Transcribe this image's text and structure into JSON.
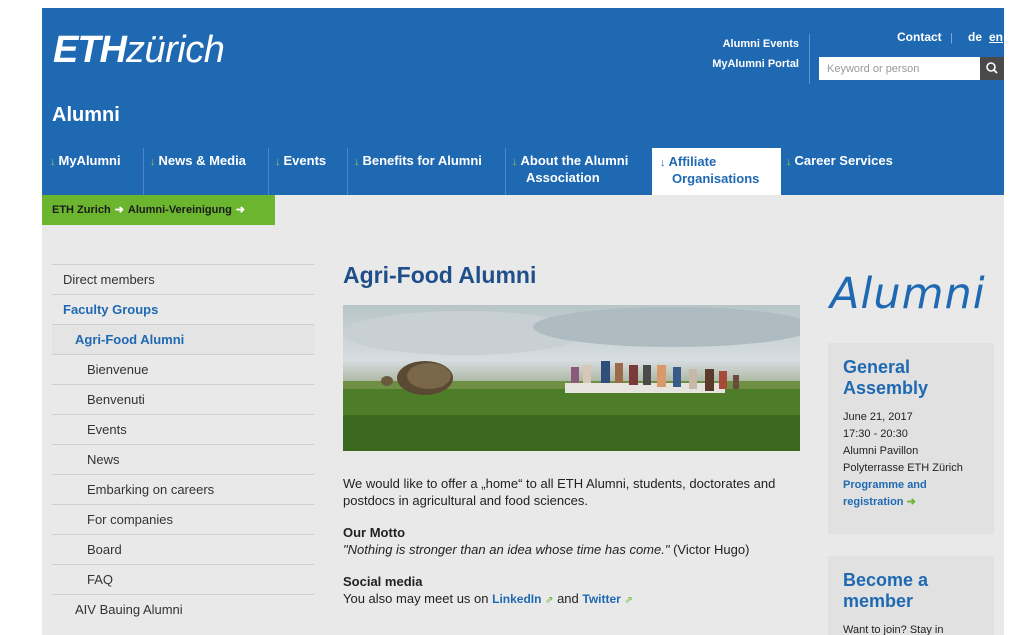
{
  "header": {
    "logo_bold": "ETH",
    "logo_light": "zürich",
    "site_title": "Alumni",
    "toplinks": [
      "Alumni Events",
      "MyAlumni Portal"
    ],
    "contact": "Contact",
    "lang_separator": "|",
    "lang_de": "de",
    "lang_en": "en",
    "search_placeholder": "Keyword or person"
  },
  "nav": {
    "items": [
      {
        "label": "MyAlumni"
      },
      {
        "label": "News & Media"
      },
      {
        "label": "Events"
      },
      {
        "label": "Benefits for Alumni"
      },
      {
        "label1": "About the Alumni",
        "label2": "Association"
      },
      {
        "label1": "Affiliate",
        "label2": "Organisations",
        "active": true
      },
      {
        "label": "Career Services"
      }
    ]
  },
  "breadcrumb": [
    "ETH Zurich",
    "Alumni-Vereinigung"
  ],
  "leftnav": [
    "Direct members",
    "Faculty Groups",
    "Agri-Food Alumni",
    "Bienvenue",
    "Benvenuti",
    "Events",
    "News",
    "Embarking on careers",
    "For companies",
    "Board",
    "FAQ",
    "AIV Bauing Alumni"
  ],
  "main": {
    "title": "Agri-Food Alumni",
    "intro": "We would like to offer a „home“ to all ETH Alumni, students, doctorates and postdocs in agricultural and food sciences.",
    "motto_heading": "Our Motto",
    "motto_quote": "\"Nothing is stronger than an idea whose time has come.\"",
    "motto_author": " (Victor Hugo)",
    "social_heading": "Social media",
    "social_text": "You also may meet us on ",
    "linkedin": "LinkedIn",
    "and": " and ",
    "twitter": "Twitter"
  },
  "sidebar": {
    "alumni_logo": "Alumni",
    "assembly": {
      "title": "General Assembly",
      "date": "June 21, 2017",
      "time": "17:30 - 20:30",
      "place1": "Alumni Pavillon",
      "place2": "Polyterrasse ETH Zürich",
      "link": "Programme and registration"
    },
    "member": {
      "title": "Become a member",
      "text": "Want to join? Stay in"
    }
  },
  "colors": {
    "brand_blue": "#1f69b3",
    "accent_green": "#6bb52f"
  }
}
